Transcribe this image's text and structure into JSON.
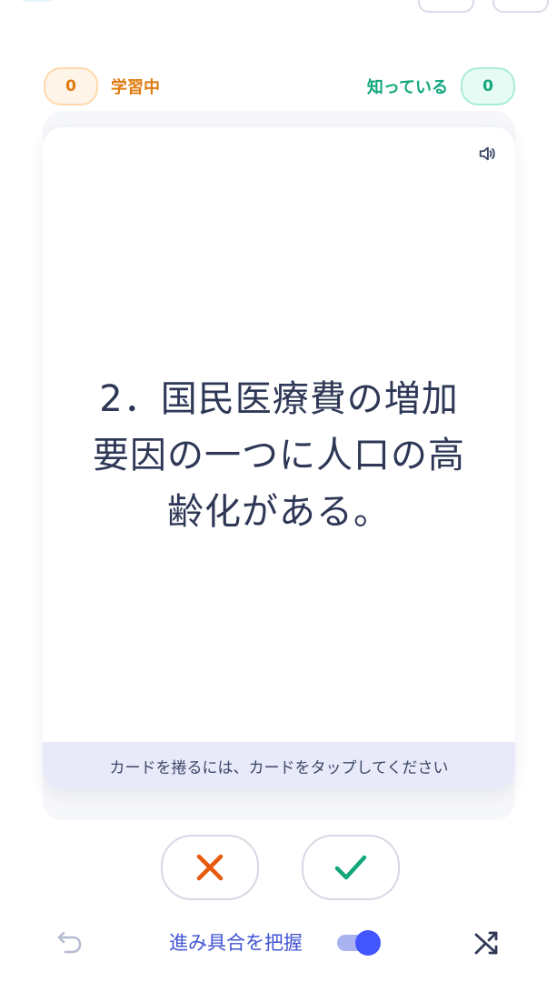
{
  "counters": {
    "learning": {
      "count": "0",
      "label": "学習中"
    },
    "known": {
      "count": "0",
      "label": "知っている"
    }
  },
  "card": {
    "text": "2．国民医療費の増加\n要因の一つに人口の高\n齢化がある。",
    "hint": "カードを捲るには、カードをタップしてください"
  },
  "controls": {
    "progress_label": "進み具合を把握",
    "progress_toggle_on": true
  },
  "icons": {
    "audio": "speaker-icon",
    "wrong": "x-icon",
    "right": "check-icon",
    "undo": "undo-icon",
    "shuffle": "shuffle-icon"
  },
  "colors": {
    "learning_accent": "#e07b10",
    "known_accent": "#13a77e",
    "primary": "#4255ff",
    "wrong_mark": "#e8590c",
    "right_mark": "#12a67b"
  }
}
